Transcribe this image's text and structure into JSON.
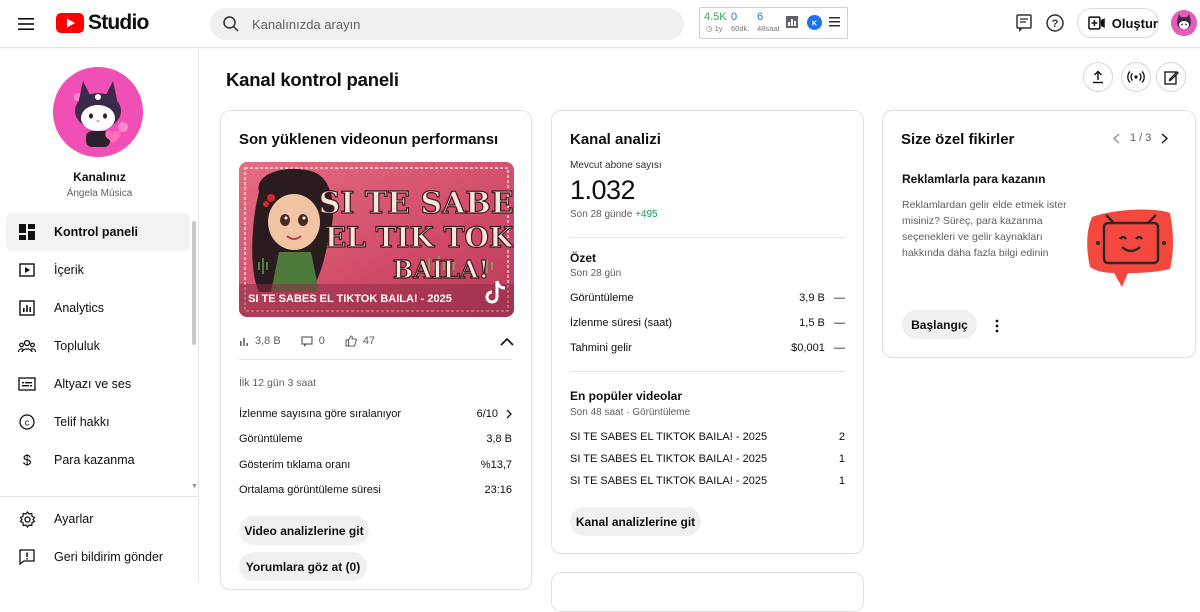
{
  "topbar": {
    "logo_text": "Studio",
    "search_placeholder": "Kanalınızda arayın",
    "extension": {
      "views": "4.5K",
      "views_sub": "1y",
      "mid": "0",
      "mid_sub": "60dk.",
      "right": "6",
      "right_sub": "48saat"
    },
    "create_label": "Oluştur"
  },
  "sidebar": {
    "channel_name": "Kanalınız",
    "channel_handle": "Ángela Música",
    "items": [
      {
        "label": "Kontrol paneli",
        "icon": "dashboard-icon"
      },
      {
        "label": "İçerik",
        "icon": "content-icon"
      },
      {
        "label": "Analytics",
        "icon": "analytics-icon"
      },
      {
        "label": "Topluluk",
        "icon": "community-icon"
      },
      {
        "label": "Altyazı ve ses",
        "icon": "subtitles-icon"
      },
      {
        "label": "Telif hakkı",
        "icon": "copyright-icon"
      },
      {
        "label": "Para kazanma",
        "icon": "dollar-icon"
      }
    ],
    "bottom_items": [
      {
        "label": "Ayarlar",
        "icon": "gear-icon"
      },
      {
        "label": "Geri bildirim gönder",
        "icon": "feedback-icon"
      }
    ]
  },
  "main": {
    "title": "Kanal kontrol paneli",
    "latest": {
      "title": "Son yüklenen videonun performansı",
      "thumb_title": "SI TE SABES EL TIKTOK BAILA! - 2025",
      "thumb_art_line1": "SI TE SABES",
      "thumb_art_line2": "EL TIK TOK",
      "thumb_art_line3": "BAILA!",
      "views": "3,8 B",
      "comments": "0",
      "likes": "47",
      "period": "İlk 12 gün 3 saat",
      "rows": [
        {
          "label": "İzlenme sayısına göre sıralanıyor",
          "value": "6/10"
        },
        {
          "label": "Görüntüleme",
          "value": "3,8 B"
        },
        {
          "label": "Gösterim tıklama oranı",
          "value": "%13,7"
        },
        {
          "label": "Ortalama görüntüleme süresi",
          "value": "23:16"
        }
      ],
      "btn_analytics": "Video analizlerine git",
      "btn_comments": "Yorumlara göz at (0)"
    },
    "analytics": {
      "title": "Kanal analizi",
      "subs_label": "Mevcut abone sayısı",
      "subs_value": "1.032",
      "subs_change_label": "Son 28 günde",
      "subs_change": "+495",
      "summary_title": "Özet",
      "summary_sub": "Son 28 gün",
      "summary_rows": [
        {
          "label": "Görüntüleme",
          "value": "3,9 B",
          "trend": "—"
        },
        {
          "label": "İzlenme süresi (saat)",
          "value": "1,5 B",
          "trend": "—"
        },
        {
          "label": "Tahmini gelir",
          "value": "$0,001",
          "trend": "—"
        }
      ],
      "top_title": "En popüler videolar",
      "top_sub": "Son 48 saat · Görüntüleme",
      "top_rows": [
        {
          "label": "SI TE SABES EL TIKTOK BAILA! - 2025",
          "value": "2"
        },
        {
          "label": "SI TE SABES EL TIKTOK BAILA! - 2025",
          "value": "1"
        },
        {
          "label": "SI TE SABES EL TIKTOK BAILA! - 2025",
          "value": "1"
        }
      ],
      "btn": "Kanal analizlerine git"
    },
    "ideas": {
      "title": "Size özel fikirler",
      "pager": "1 / 3",
      "idea_title": "Reklamlarla para kazanın",
      "idea_text": "Reklamlardan gelir elde etmek ister misiniz? Süreç, para kazanma seçenekleri ve gelir kaynakları hakkında daha fazla bilgi edinin",
      "btn": "Başlangıç"
    }
  },
  "colors": {
    "youtube_red": "#ff0000",
    "positive_green": "#0f9d58",
    "ext_green": "#34a853",
    "ext_blue": "#1a73e8",
    "idea_red": "#f4483e"
  }
}
